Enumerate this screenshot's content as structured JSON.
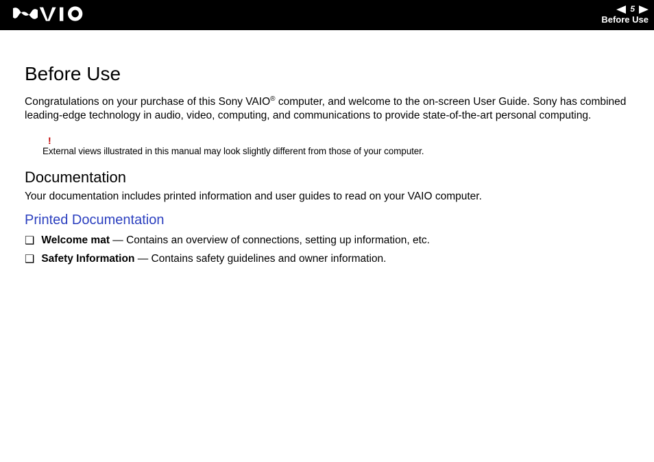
{
  "header": {
    "page_number": "5",
    "section": "Before Use"
  },
  "page": {
    "title": "Before Use",
    "intro_before_sup": "Congratulations on your purchase of this Sony VAIO",
    "intro_sup": "®",
    "intro_after_sup": " computer, and welcome to the on-screen User Guide. Sony has combined leading-edge technology in audio, video, computing, and communications to provide state-of-the-art personal computing.",
    "note_symbol": "!",
    "note_text": "External views illustrated in this manual may look slightly different from those of your computer.",
    "h2": "Documentation",
    "doc_intro": "Your documentation includes printed information and user guides to read on your VAIO computer.",
    "h3": "Printed Documentation",
    "items": [
      {
        "name": "Welcome mat",
        "desc": " — Contains an overview of connections, setting up information, etc."
      },
      {
        "name": "Safety Information",
        "desc": " — Contains safety guidelines and owner information."
      }
    ]
  }
}
